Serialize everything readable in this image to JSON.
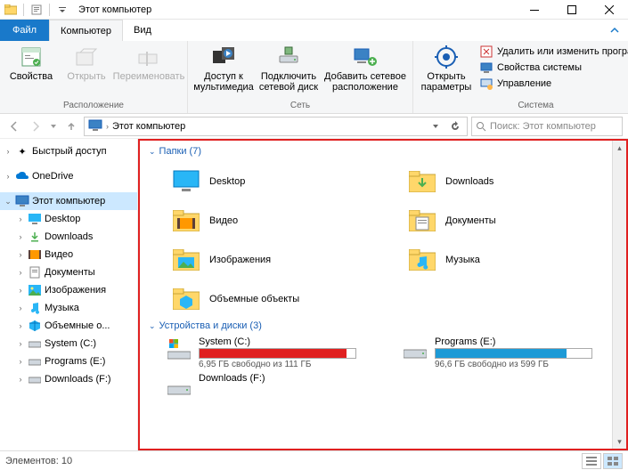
{
  "window": {
    "title": "Этот компьютер"
  },
  "tabs": {
    "file": "Файл",
    "computer": "Компьютер",
    "view": "Вид"
  },
  "ribbon": {
    "loc": {
      "label": "Расположение",
      "props": "Свойства",
      "open": "Открыть",
      "rename": "Переименовать"
    },
    "net": {
      "label": "Сеть",
      "media": "Доступ к мультимедиа",
      "map": "Подключить сетевой диск",
      "add": "Добавить сетевое расположение"
    },
    "sys": {
      "label": "Система",
      "open": "Открыть параметры",
      "uninstall": "Удалить или изменить программу",
      "sysprops": "Свойства системы",
      "manage": "Управление"
    }
  },
  "address": {
    "path": "Этот компьютер"
  },
  "search": {
    "placeholder": "Поиск: Этот компьютер"
  },
  "tree": {
    "quick": "Быстрый доступ",
    "onedrive": "OneDrive",
    "thispc": "Этот компьютер",
    "desktop": "Desktop",
    "downloads": "Downloads",
    "video": "Видео",
    "documents": "Документы",
    "pictures": "Изображения",
    "music": "Музыка",
    "objects3d": "Объемные о...",
    "sysc": "System (C:)",
    "proge": "Programs (E:)",
    "dlf": "Downloads (F:)"
  },
  "content": {
    "folders_hdr": "Папки (7)",
    "drives_hdr": "Устройства и диски (3)",
    "folders_left": [
      "Desktop",
      "Видео",
      "Изображения",
      "Объемные объекты"
    ],
    "folders_right": [
      "Downloads",
      "Документы",
      "Музыка"
    ],
    "drives": {
      "c": {
        "name": "System (C:)",
        "free": "6,95 ГБ свободно из 111 ГБ",
        "pct": 94,
        "color": "#e02020"
      },
      "e": {
        "name": "Programs (E:)",
        "free": "96,6 ГБ свободно из 599 ГБ",
        "pct": 84,
        "color": "#1d9ad6"
      },
      "f": {
        "name": "Downloads (F:)"
      }
    }
  },
  "status": {
    "items": "Элементов: 10"
  }
}
